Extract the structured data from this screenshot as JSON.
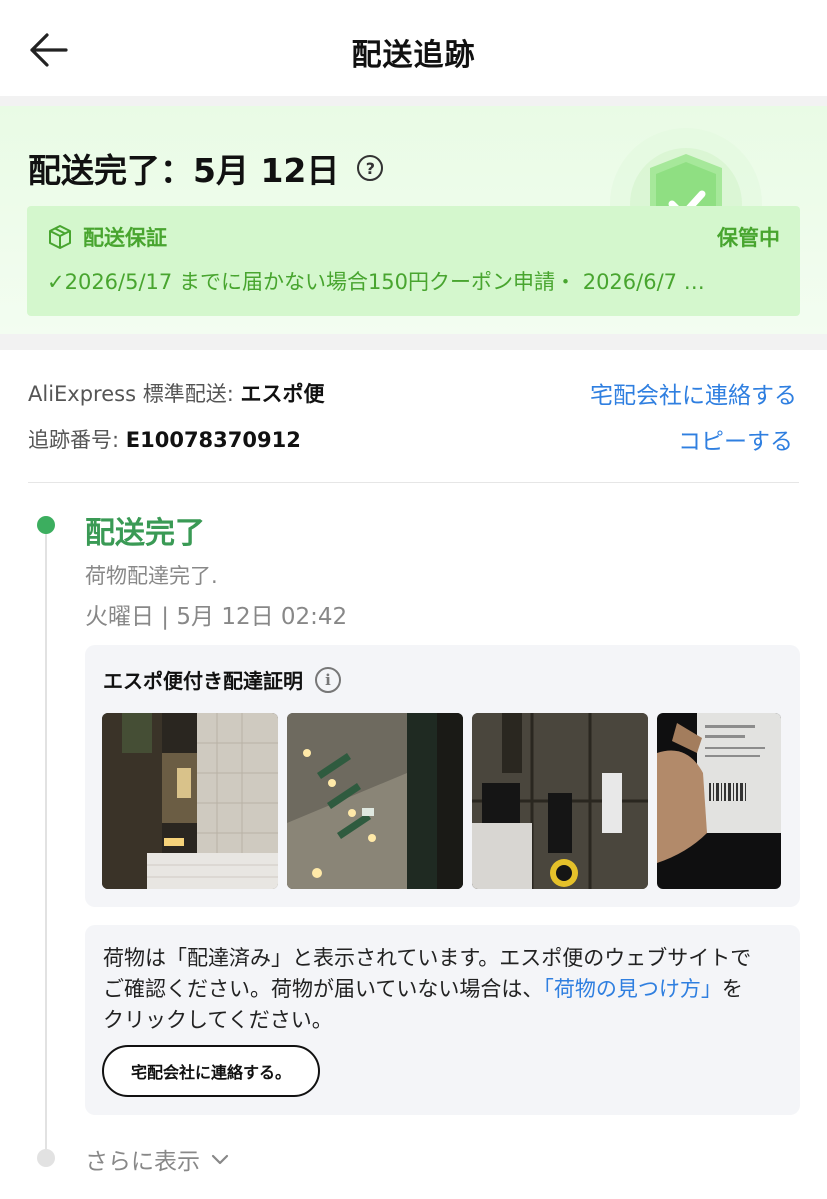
{
  "header": {
    "title": "配送追跡",
    "back_icon": "back-arrow-icon"
  },
  "status": {
    "headline": "配送完了：5月 12日",
    "help_icon": "question-circle-icon",
    "help_glyph": "?"
  },
  "guarantee": {
    "icon": "package-box-icon",
    "title": "配送保証",
    "status": "保管中",
    "description": "✓2026/5/17 までに届かない場合150円クーポン申請・ 2026/6/7 …",
    "accent_color": "#48a52f"
  },
  "carrier": {
    "service_label": "AliExpress 標準配送: ",
    "service_name": "エスポ便",
    "tracking_label": "追跡番号: ",
    "tracking_number": "E10078370912",
    "contact_link": "宅配会社に連絡する",
    "copy_link": "コピーする",
    "link_color": "#2f7fe0"
  },
  "event": {
    "title": "配送完了",
    "description": "荷物配達完了.",
    "time": "火曜日 | 5月 12日 02:42",
    "accent_color": "#3a9a55"
  },
  "proof": {
    "title": "エスポ便付き配達証明",
    "info_icon": "info-circle-icon",
    "info_glyph": "i",
    "photos": [
      "delivery-photo-1",
      "delivery-photo-2",
      "delivery-photo-3",
      "delivery-photo-4"
    ]
  },
  "notice": {
    "text_before": " 荷物は「配達済み」と表示されています。エスポ便のウェブサイトでご確認ください。荷物が届いていない場合は、",
    "link_text": "「荷物の見つけ方」",
    "text_after": "をクリックしてください。",
    "button_label": "宅配会社に連絡する。"
  },
  "more": {
    "label": "さらに表示",
    "icon": "chevron-down-icon"
  }
}
